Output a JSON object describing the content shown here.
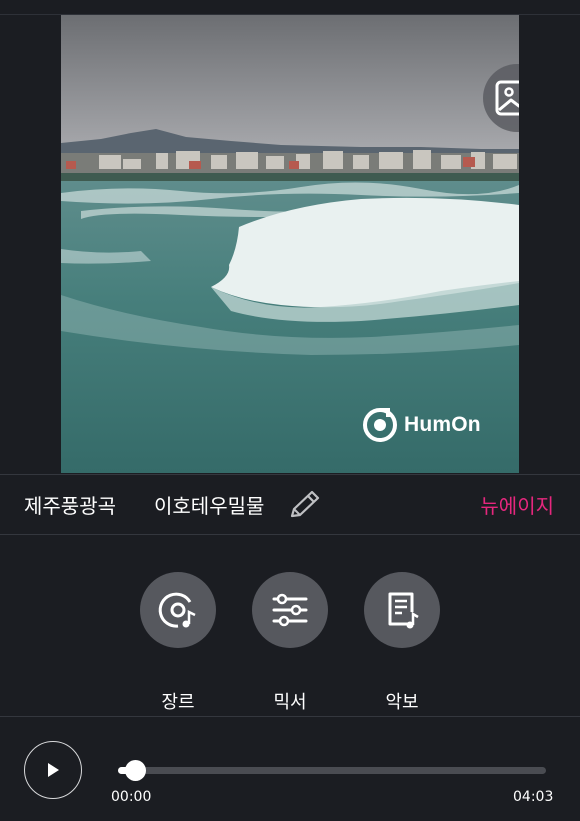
{
  "cover": {
    "watermark": "HumOn",
    "change_image_icon": "image-icon",
    "logo_icon": "humon-logo-icon"
  },
  "song": {
    "title": "제주풍광곡",
    "singer": "이호테우밀물",
    "genre": "뉴에이지",
    "edit_icon": "pencil-icon"
  },
  "actions": [
    {
      "label": "장르",
      "icon": "disc-music-icon"
    },
    {
      "label": "믹서",
      "icon": "sliders-icon"
    },
    {
      "label": "악보",
      "icon": "sheet-music-icon"
    }
  ],
  "player": {
    "current_time": "00:00",
    "total_time": "04:03",
    "progress": 0.04,
    "play_icon": "play-icon"
  },
  "colors": {
    "background": "#1b1d22",
    "accent": "#e6277e",
    "button": "#56585e"
  }
}
